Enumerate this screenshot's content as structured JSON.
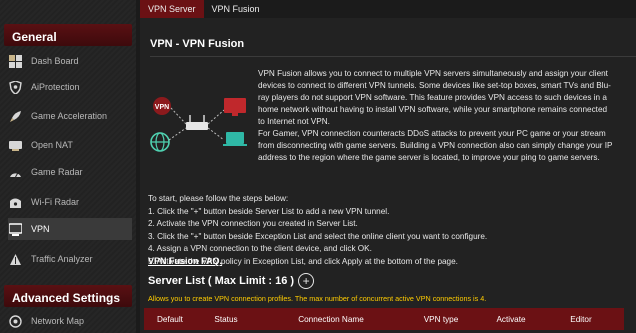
{
  "sidebar": {
    "general_header": "General",
    "items": [
      {
        "label": "Dash Board",
        "icon": "dashboard-icon"
      },
      {
        "label": "AiProtection",
        "icon": "shield-icon"
      },
      {
        "label": "Game Acceleration",
        "icon": "rocket-icon"
      },
      {
        "label": "Open NAT",
        "icon": "nat-icon"
      },
      {
        "label": "Game Radar",
        "icon": "radar-icon"
      },
      {
        "label": "Wi-Fi Radar",
        "icon": "wifi-radar-icon"
      },
      {
        "label": "VPN",
        "icon": "vpn-icon"
      },
      {
        "label": "Traffic Analyzer",
        "icon": "traffic-icon"
      }
    ],
    "advanced_header": "Advanced Settings",
    "adv_items": [
      {
        "label": "Network Map",
        "icon": "network-map-icon"
      }
    ]
  },
  "tabs": [
    "VPN Server",
    "VPN Fusion"
  ],
  "page": {
    "title": "VPN - VPN Fusion",
    "description": [
      "VPN Fusion allows you to connect to multiple VPN servers simultaneously and assign your client",
      "devices to connect to different VPN tunnels. Some devices like set-top boxes, smart TVs and Blu-",
      "ray players do not support VPN software. This feature provides VPN access to such devices in a",
      "home network without having to install VPN software, while your smartphone remains connected",
      "to Internet not VPN.",
      "For Gamer, VPN connection counteracts DDoS attacks to prevent your PC game or your stream",
      "from disconnecting with game servers. Building a VPN connection also can simply change your IP",
      "address to the region where the game server is located, to improve your ping to game servers."
    ],
    "illus_label": "VPN",
    "steps": [
      "To start, please follow the steps below:",
      "1. Click the \"+\" button beside Server List to add a new VPN tunnel.",
      "2. Activate the VPN connection you created in Server List.",
      "3. Click the \"+\" button beside Exception List and select the online client you want to configure.",
      "4. Assign a VPN connection to the client device, and click OK.",
      "5. Activate the VPN policy in Exception List, and click Apply at the bottom of the page."
    ],
    "faq": "VPN Fusion FAQ.",
    "server_list_title": "Server List ( Max Limit : 16 )",
    "add_symbol": "+",
    "note": "Allows you to create VPN connection profiles. The max number of concurrent active VPN connections is 4.",
    "table_headers": [
      "Default",
      "Status",
      "Connection Name",
      "VPN type",
      "Activate",
      "Editor"
    ]
  },
  "colors": {
    "accent": "#6b1114",
    "note": "#ffcc00",
    "background": "#222222"
  }
}
